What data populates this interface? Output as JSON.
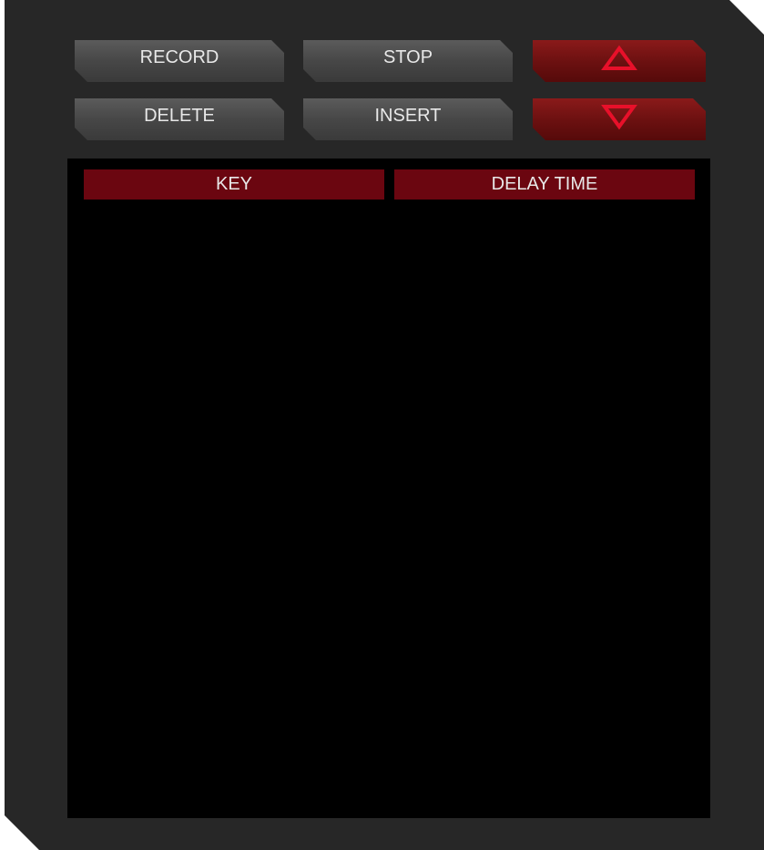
{
  "toolbar": {
    "record_label": "RECORD",
    "stop_label": "STOP",
    "delete_label": "DELETE",
    "insert_label": "INSERT",
    "move_up_icon": "triangle-up-icon",
    "move_down_icon": "triangle-down-icon"
  },
  "table": {
    "columns": [
      "KEY",
      "DELAY TIME"
    ],
    "rows": []
  },
  "colors": {
    "panel": "#272727",
    "button": "#4a4a4a",
    "accent_button": "#6a1010",
    "icon": "#e8102a",
    "header": "#6b0610",
    "list_background": "#000000"
  }
}
